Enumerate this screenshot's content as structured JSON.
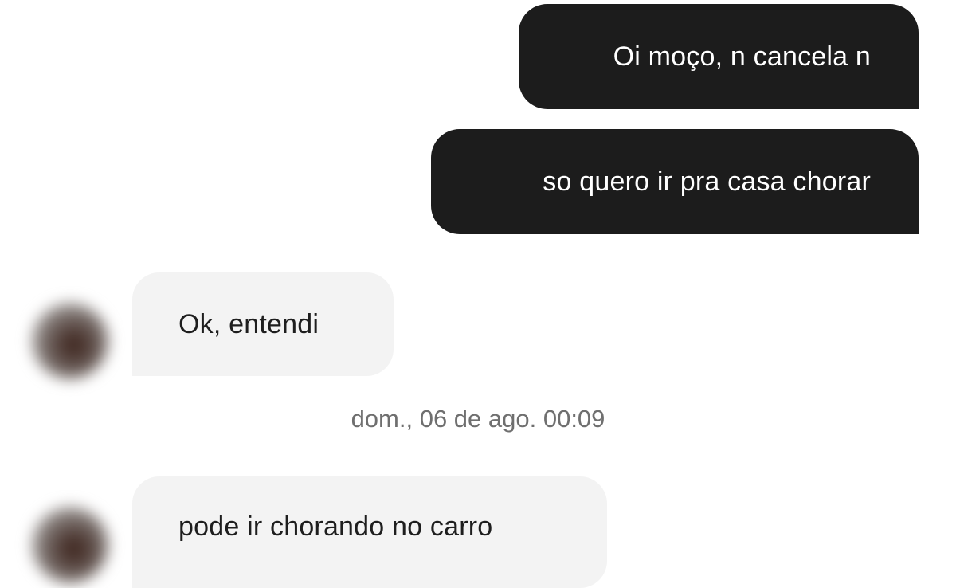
{
  "messages": [
    {
      "direction": "outgoing",
      "text": "Oi moço, n cancela n"
    },
    {
      "direction": "outgoing",
      "text": "so quero ir pra casa chorar"
    },
    {
      "direction": "incoming",
      "text": "Ok, entendi"
    },
    {
      "direction": "incoming",
      "text": "pode ir chorando no carro"
    }
  ],
  "timestamp": "dom., 06 de ago. 00:09",
  "colors": {
    "outgoing_bubble": "#1c1c1c",
    "outgoing_text": "#ffffff",
    "incoming_bubble": "#f3f3f3",
    "incoming_text": "#1e1e1e",
    "timestamp_text": "#6f6f6f"
  }
}
